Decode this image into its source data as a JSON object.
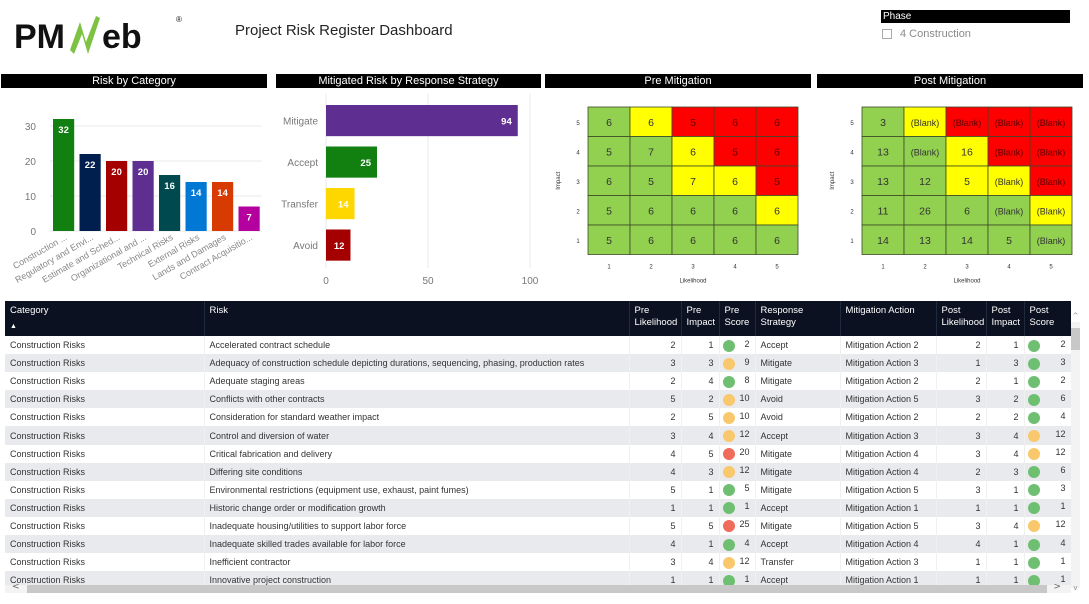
{
  "header": {
    "logo_text": "PMWeb",
    "title": "Project Risk Register Dashboard"
  },
  "slicer": {
    "title": "Phase",
    "items": [
      {
        "label": "4 Construction",
        "checked": false
      }
    ]
  },
  "panels": {
    "risk_by_category": "Risk by Category",
    "mitigated_by_strategy": "Mitigated Risk by Response Strategy",
    "pre_mitigation": "Pre Mitigation",
    "post_mitigation": "Post Mitigation"
  },
  "colors": {
    "heat_green": "#92d050",
    "heat_yellow": "#ffff00",
    "heat_red": "#ff0000",
    "dot_green": "#6fbf73",
    "dot_amber": "#f9c86d",
    "dot_red": "#ef6b5a",
    "header_dark": "#0b1120"
  },
  "chart_data": [
    {
      "type": "bar",
      "title": "Risk by Category",
      "categories": [
        "Construction ...",
        "Regulatory and Envi...",
        "Estimate and Sched...",
        "Organizational and ...",
        "Technical Risks",
        "External Risks",
        "Lands and Damages",
        "Contract Acquisitio..."
      ],
      "values": [
        32,
        22,
        20,
        20,
        16,
        14,
        14,
        7
      ],
      "colors": [
        "#118011",
        "#001f4e",
        "#a50000",
        "#5e2e91",
        "#004a4f",
        "#0078d4",
        "#d83b01",
        "#b4009e"
      ],
      "yticks": [
        0,
        10,
        20,
        30
      ],
      "ylim": [
        0,
        34
      ],
      "grid": true,
      "xlabel": "",
      "ylabel": ""
    },
    {
      "type": "bar",
      "orientation": "horizontal",
      "title": "Mitigated Risk by Response Strategy",
      "categories": [
        "Mitigate",
        "Accept",
        "Transfer",
        "Avoid"
      ],
      "values": [
        94,
        25,
        14,
        12
      ],
      "colors": [
        "#5e2e91",
        "#118011",
        "#ffd700",
        "#a50000"
      ],
      "xticks": [
        0,
        50,
        100
      ],
      "xlim": [
        0,
        100
      ],
      "grid": true
    },
    {
      "type": "heatmap",
      "title": "Pre Mitigation",
      "xlabel": "Likelihood",
      "ylabel": "Impact",
      "x": [
        1,
        2,
        3,
        4,
        5
      ],
      "y": [
        5,
        4,
        3,
        2,
        1
      ],
      "values": [
        [
          "6",
          "6",
          "5",
          "6",
          "6"
        ],
        [
          "5",
          "7",
          "6",
          "5",
          "6"
        ],
        [
          "6",
          "5",
          "7",
          "6",
          "5"
        ],
        [
          "5",
          "6",
          "6",
          "6",
          "6"
        ],
        [
          "5",
          "6",
          "6",
          "6",
          "6"
        ]
      ],
      "levels": [
        [
          "G",
          "Y",
          "R",
          "R",
          "R"
        ],
        [
          "G",
          "G",
          "Y",
          "R",
          "R"
        ],
        [
          "G",
          "G",
          "Y",
          "Y",
          "R"
        ],
        [
          "G",
          "G",
          "G",
          "G",
          "Y"
        ],
        [
          "G",
          "G",
          "G",
          "G",
          "G"
        ]
      ]
    },
    {
      "type": "heatmap",
      "title": "Post Mitigation",
      "xlabel": "Likelihood",
      "ylabel": "Impact",
      "x": [
        1,
        2,
        3,
        4,
        5
      ],
      "y": [
        5,
        4,
        3,
        2,
        1
      ],
      "values": [
        [
          "3",
          "(Blank)",
          "(Blank)",
          "(Blank)",
          "(Blank)"
        ],
        [
          "13",
          "(Blank)",
          "16",
          "(Blank)",
          "(Blank)"
        ],
        [
          "13",
          "12",
          "5",
          "(Blank)",
          "(Blank)"
        ],
        [
          "11",
          "26",
          "6",
          "(Blank)",
          "(Blank)"
        ],
        [
          "14",
          "13",
          "14",
          "5",
          "(Blank)"
        ]
      ],
      "levels": [
        [
          "G",
          "Y",
          "R",
          "R",
          "R"
        ],
        [
          "G",
          "G",
          "Y",
          "R",
          "R"
        ],
        [
          "G",
          "G",
          "Y",
          "Y",
          "R"
        ],
        [
          "G",
          "G",
          "G",
          "G",
          "Y"
        ],
        [
          "G",
          "G",
          "G",
          "G",
          "G"
        ]
      ]
    }
  ],
  "table": {
    "columns": [
      {
        "label": "Category",
        "sorted": "asc"
      },
      {
        "label": "Risk"
      },
      {
        "label": "Pre Likelihood"
      },
      {
        "label": "Pre Impact"
      },
      {
        "label": "Pre Score"
      },
      {
        "label": "Response Strategy"
      },
      {
        "label": "Mitigation Action"
      },
      {
        "label": "Post Likelihood"
      },
      {
        "label": "Post Impact"
      },
      {
        "label": "Post Score"
      }
    ],
    "rows": [
      [
        "Construction Risks",
        "Accelerated contract schedule",
        2,
        1,
        2,
        "Accept",
        "Mitigation Action 2",
        2,
        1,
        2
      ],
      [
        "Construction Risks",
        "Adequacy of construction schedule depicting durations, sequencing, phasing, production rates",
        3,
        3,
        9,
        "Mitigate",
        "Mitigation Action 3",
        1,
        3,
        3
      ],
      [
        "Construction Risks",
        "Adequate staging areas",
        2,
        4,
        8,
        "Mitigate",
        "Mitigation Action 2",
        2,
        1,
        2
      ],
      [
        "Construction Risks",
        "Conflicts with other contracts",
        5,
        2,
        10,
        "Avoid",
        "Mitigation Action 5",
        3,
        2,
        6
      ],
      [
        "Construction Risks",
        "Consideration for standard weather impact",
        2,
        5,
        10,
        "Avoid",
        "Mitigation Action 2",
        2,
        2,
        4
      ],
      [
        "Construction Risks",
        "Control and diversion of water",
        3,
        4,
        12,
        "Accept",
        "Mitigation Action 3",
        3,
        4,
        12
      ],
      [
        "Construction Risks",
        "Critical fabrication and delivery",
        4,
        5,
        20,
        "Mitigate",
        "Mitigation Action 4",
        3,
        4,
        12
      ],
      [
        "Construction Risks",
        "Differing site conditions",
        4,
        3,
        12,
        "Mitigate",
        "Mitigation Action 4",
        2,
        3,
        6
      ],
      [
        "Construction Risks",
        "Environmental restrictions (equipment use, exhaust, paint fumes)",
        5,
        1,
        5,
        "Mitigate",
        "Mitigation Action 5",
        3,
        1,
        3
      ],
      [
        "Construction Risks",
        "Historic change order or modification growth",
        1,
        1,
        1,
        "Accept",
        "Mitigation Action 1",
        1,
        1,
        1
      ],
      [
        "Construction Risks",
        "Inadequate housing/utilities to support labor force",
        5,
        5,
        25,
        "Mitigate",
        "Mitigation Action 5",
        3,
        4,
        12
      ],
      [
        "Construction Risks",
        "Inadequate skilled trades available for labor force",
        4,
        1,
        4,
        "Accept",
        "Mitigation Action 4",
        4,
        1,
        4
      ],
      [
        "Construction Risks",
        "Inefficient contractor",
        3,
        4,
        12,
        "Transfer",
        "Mitigation Action 3",
        1,
        1,
        1
      ],
      [
        "Construction Risks",
        "Innovative project construction",
        1,
        1,
        1,
        "Accept",
        "Mitigation Action 1",
        1,
        1,
        1
      ]
    ]
  },
  "scrollbars": {
    "up": "^",
    "down": "v",
    "left": "<",
    "right": ">"
  }
}
